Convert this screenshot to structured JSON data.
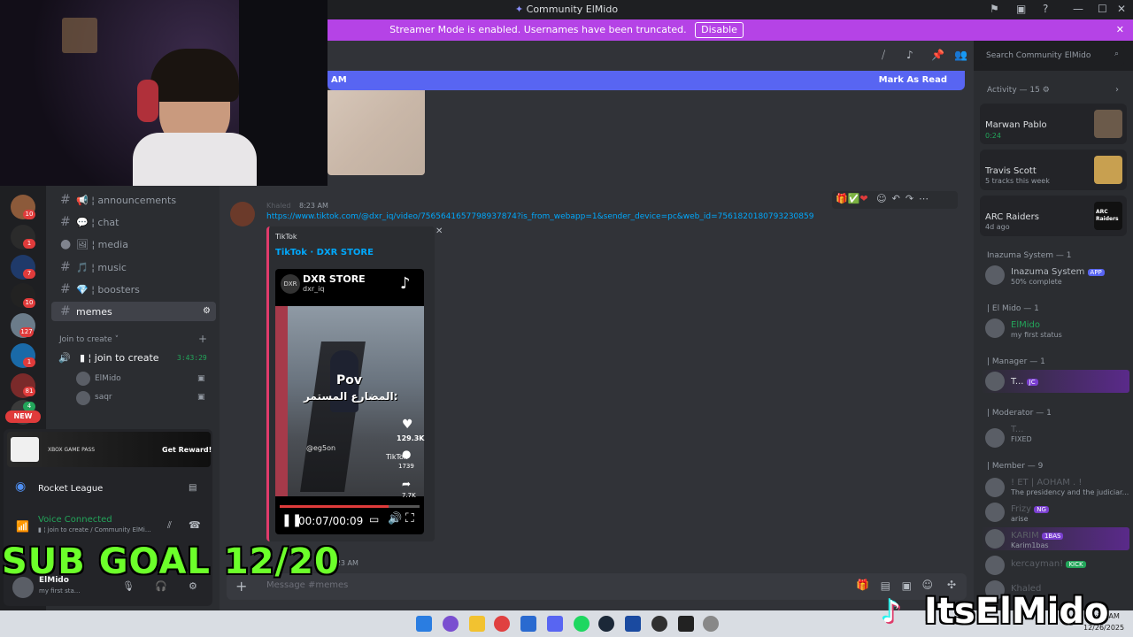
{
  "window": {
    "title": "Community ElMido"
  },
  "banner": {
    "text": "Streamer Mode is enabled. Usernames have been truncated.",
    "button": "Disable"
  },
  "search": {
    "placeholder": "Search Community ElMido"
  },
  "newbar": {
    "time": "AM",
    "mark_read": "Mark As Read"
  },
  "channels": [
    {
      "name": "announcements",
      "emoji": "📢",
      "selected": false
    },
    {
      "name": "chat",
      "emoji": "💬",
      "selected": false
    },
    {
      "name": "media",
      "emoji": "🖼",
      "selected": false
    },
    {
      "name": "music",
      "emoji": "🎵",
      "selected": false
    },
    {
      "name": "boosters",
      "emoji": "💎",
      "selected": false
    },
    {
      "name": "memes",
      "emoji": "",
      "selected": true
    }
  ],
  "voice": {
    "category": "Join to create",
    "channel": "join to create",
    "timer": "3:43:29",
    "users": [
      {
        "name": "ElMido"
      },
      {
        "name": "saqr"
      }
    ]
  },
  "servers": {
    "badges": [
      "10",
      "1",
      "7",
      "10",
      "127",
      "1",
      "81",
      "4"
    ],
    "new_label": "NEW"
  },
  "promo": {
    "brand": "XBOX GAME PASS",
    "button": "Get Reward!"
  },
  "game": {
    "name": "Rocket League"
  },
  "voice_status": {
    "title": "Voice Connected",
    "sub": "join to create / Community ElMi..."
  },
  "user": {
    "name": "ElMido",
    "status": "my first sta..."
  },
  "message": {
    "time": "8:23 AM",
    "author": "Khaled",
    "link": "https://www.tiktok.com/@dxr_iq/video/7565641657798937874?is_from_webapp=1&sender_device=pc&web_id=7561820180793230859",
    "embed": {
      "provider": "TikTok",
      "title": "TikTok · DXR STORE",
      "account": "DXR STORE",
      "handle": "dxr_iq",
      "caption_en": "Pov",
      "caption_ar": "المضارع المستمر:",
      "likes": "129.3K",
      "comments": "1739",
      "shares": "7.7K",
      "watermark": "TikTok",
      "player_time": "00:07/00:09",
      "progress": 0.78,
      "credit": "@eg5on"
    }
  },
  "next_message": {
    "time": "8:23 AM"
  },
  "input": {
    "placeholder": "Message #memes"
  },
  "activity": {
    "header": "Activity — 15",
    "cards": [
      {
        "name": "Marwan Pablo",
        "sub": "0:24"
      },
      {
        "name": "Travis Scott",
        "sub": "5 tracks this week"
      },
      {
        "name": "ARC Raiders",
        "sub": "4d ago",
        "thumb": "ARC Raiders"
      }
    ]
  },
  "member_groups": [
    {
      "header": "Inazuma System — 1",
      "members": [
        {
          "name": "Inazuma System",
          "tag": "APP",
          "sub": "50% complete"
        }
      ]
    },
    {
      "header": "| El Mido — 1",
      "members": [
        {
          "name": "ElMido",
          "sub": "my first status"
        }
      ]
    },
    {
      "header": "| Manager — 1",
      "members": [
        {
          "name": "T...",
          "tag": "JC"
        }
      ]
    },
    {
      "header": "| Moderator — 1",
      "members": [
        {
          "name": "T...",
          "sub": "FIXED"
        }
      ]
    },
    {
      "header": "| Member — 9",
      "members": [
        {
          "name": "! ET | AOHAM . !",
          "sub": "The presidency and the judiciar..."
        },
        {
          "name": "Frizy",
          "tag": "NG",
          "sub": "arise"
        },
        {
          "name": "KARIM",
          "tag": "1BAS",
          "sub": "Karim1bas"
        },
        {
          "name": "kercayman!",
          "tag": "KICK"
        },
        {
          "name": "Khaled"
        }
      ]
    }
  ],
  "overlay": {
    "sub_goal": "SUB GOAL 12/20",
    "brand": "ItsElMido"
  },
  "clock": {
    "time": "8:25 AM",
    "date": "12/26/2025"
  },
  "colors": {
    "accent": "#5865f2",
    "banner": "#b543e6",
    "online": "#23a55a",
    "subgoal": "#6cff2a"
  }
}
